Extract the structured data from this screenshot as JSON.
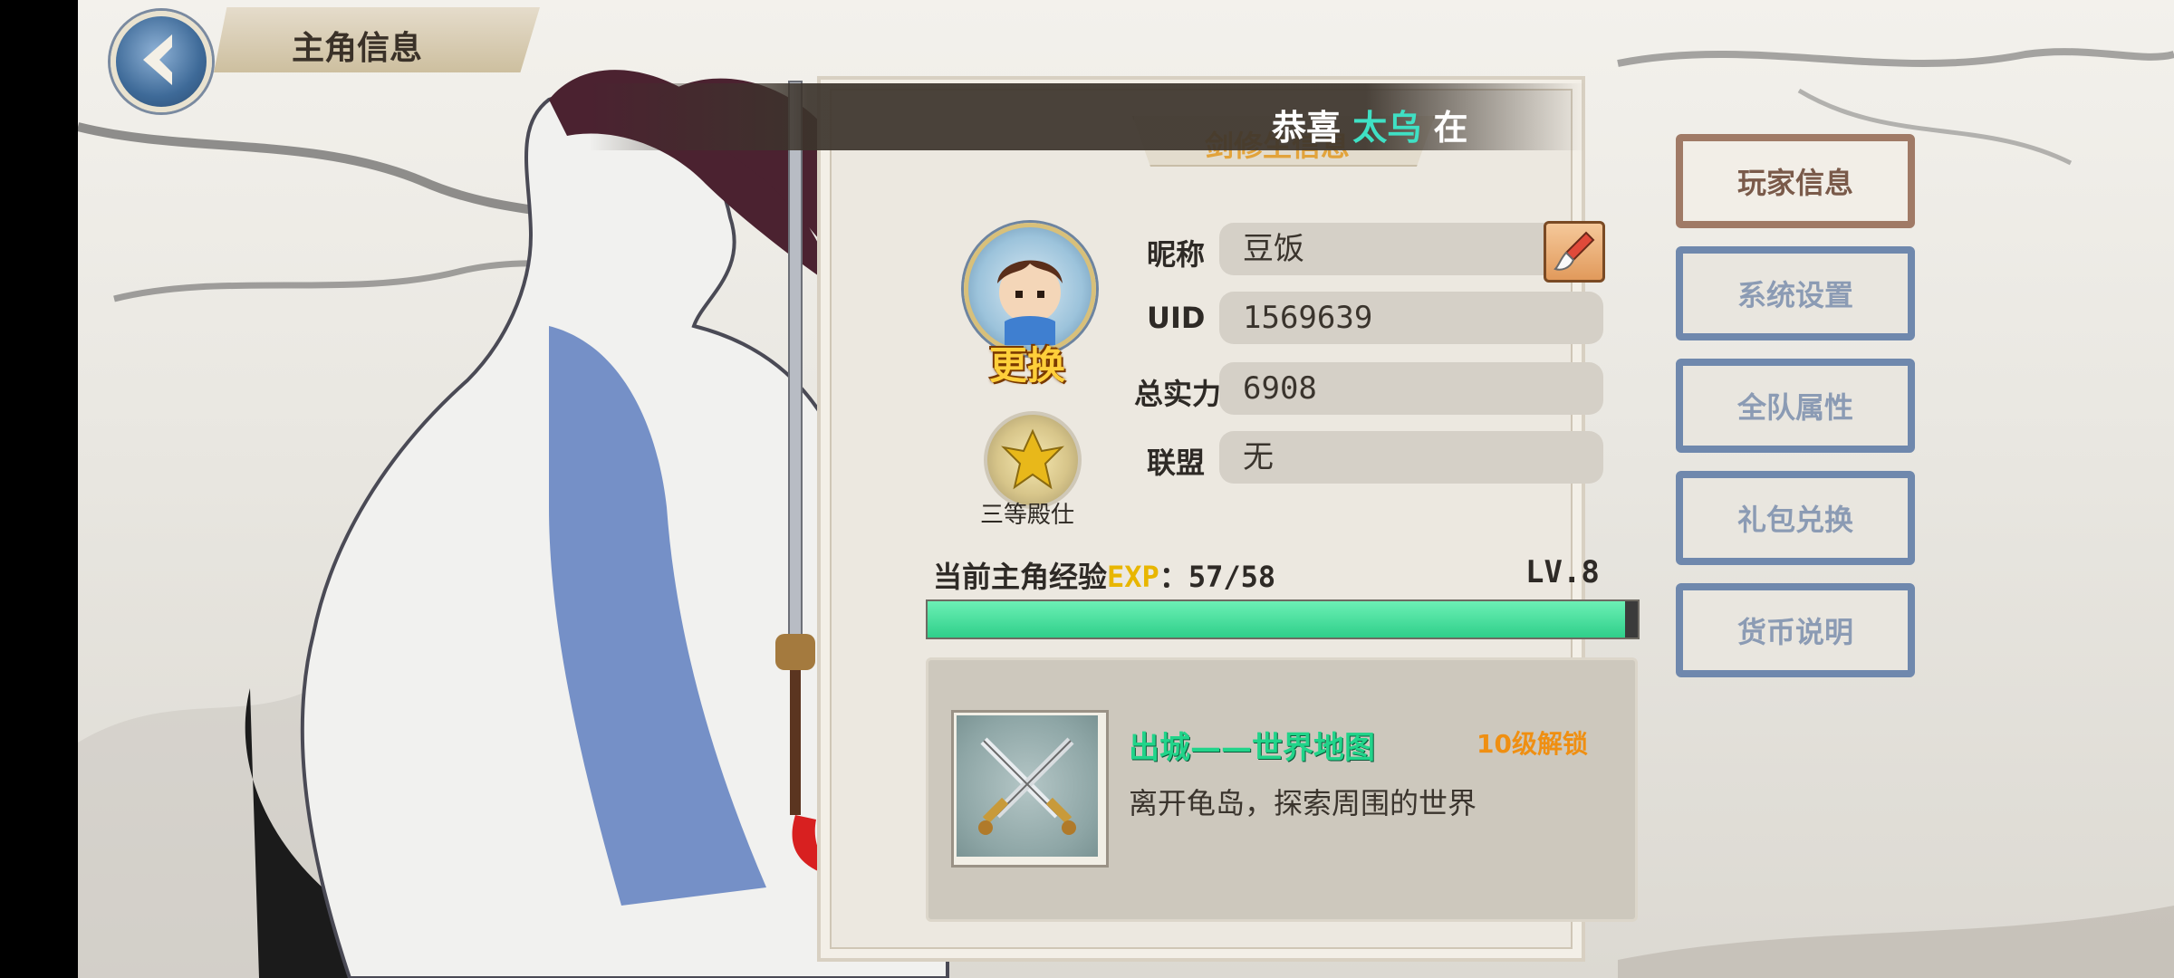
{
  "header": {
    "title": "主角信息"
  },
  "announcement": {
    "prefix": "恭喜",
    "name": "太乌",
    "suffix": "在"
  },
  "panel": {
    "subtab_label": "剑修生信息",
    "avatar": {
      "change_label": "更换"
    },
    "rank": {
      "label": "三等殿仕"
    },
    "fields": {
      "nickname_label": "昵称",
      "nickname_value": "豆饭",
      "uid_label": "UID",
      "uid_value": "1569639",
      "power_label": "总实力",
      "power_value": "6908",
      "alliance_label": "联盟",
      "alliance_value": "无"
    },
    "exp": {
      "label": "当前主角经验",
      "tag": "EXP",
      "separator": "：",
      "value": "57/58",
      "current": 57,
      "max": 58,
      "level": "LV.8"
    },
    "unlock": {
      "title": "出城——世界地图",
      "requirement": "10级解锁",
      "description": "离开龟岛，探索周围的世界"
    }
  },
  "menu": {
    "items": [
      {
        "label": "玩家信息",
        "active": true
      },
      {
        "label": "系统设置",
        "active": false
      },
      {
        "label": "全队属性",
        "active": false
      },
      {
        "label": "礼包兑换",
        "active": false
      },
      {
        "label": "货币说明",
        "active": false
      }
    ]
  },
  "colors": {
    "accent_green": "#2fcf8a",
    "menu_border": "#6f88ad",
    "menu_active_border": "#a07a66",
    "unlock_orange": "#ef8f12"
  },
  "icons": [
    "back-arrow-icon",
    "edit-brush-icon",
    "rank-emblem-icon",
    "crossed-swords-icon"
  ]
}
